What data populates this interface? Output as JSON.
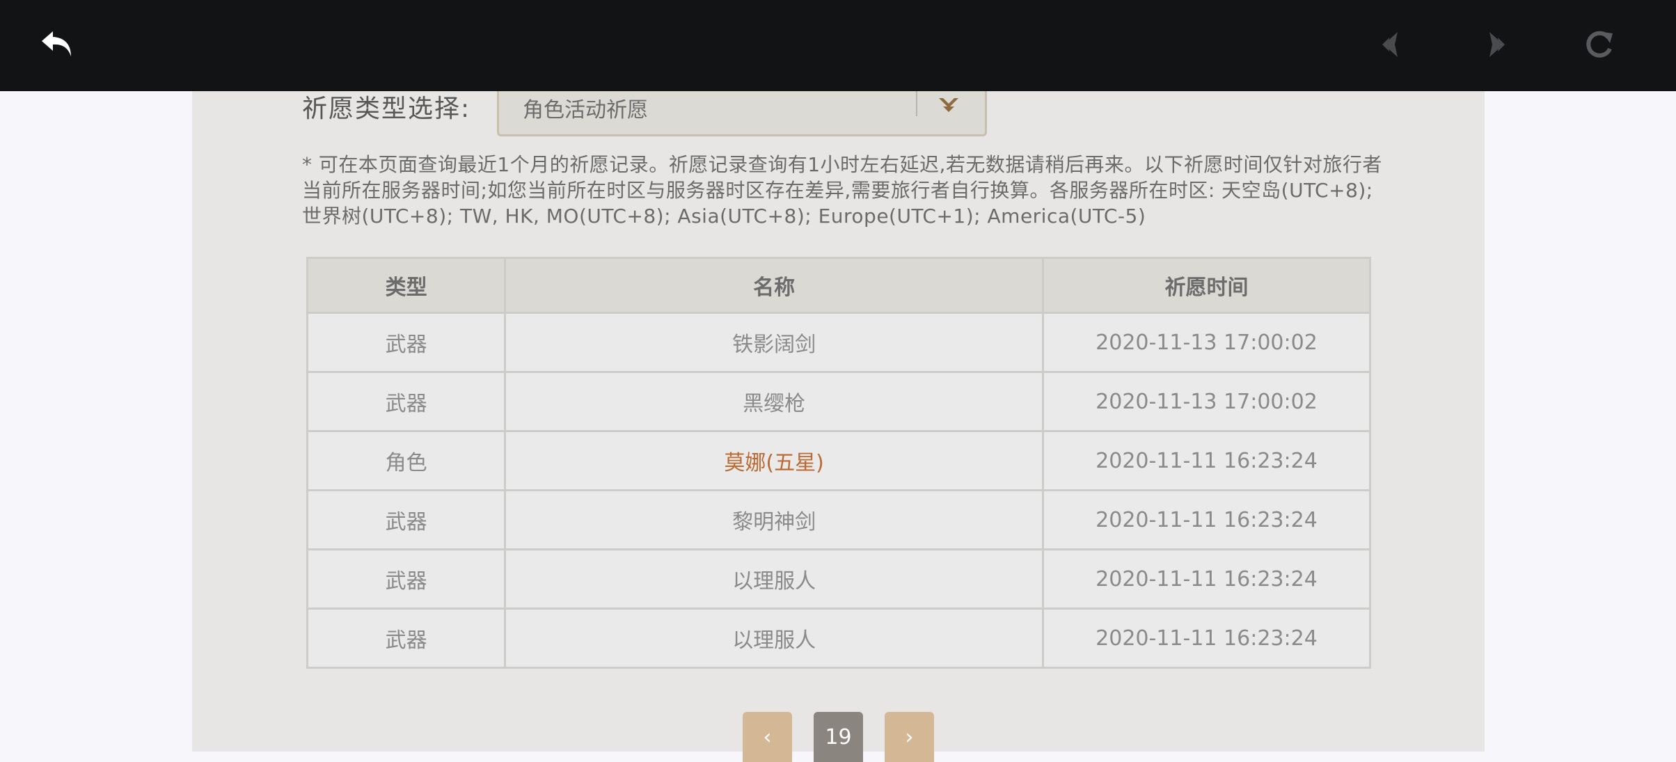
{
  "topbar": {
    "back_icon": "back-arrow-icon",
    "prev_icon": "prev-page-icon",
    "next_icon": "next-page-icon",
    "refresh_icon": "refresh-icon"
  },
  "selector": {
    "label": "祈愿类型选择:",
    "value": "角色活动祈愿"
  },
  "notice": "* 可在本页面查询最近1个月的祈愿记录。祈愿记录查询有1小时左右延迟,若无数据请稍后再来。以下祈愿时间仅针对旅行者当前所在服务器时间;如您当前所在时区与服务器时区存在差异,需要旅行者自行换算。各服务器所在时区: 天空岛(UTC+8); 世界树(UTC+8); TW, HK, MO(UTC+8); Asia(UTC+8); Europe(UTC+1); America(UTC-5)",
  "table": {
    "headers": [
      "类型",
      "名称",
      "祈愿时间"
    ],
    "rows": [
      {
        "type": "武器",
        "name": "铁影阔剑",
        "time": "2020-11-13 17:00:02",
        "highlight": false
      },
      {
        "type": "武器",
        "name": "黑缨枪",
        "time": "2020-11-13 17:00:02",
        "highlight": false
      },
      {
        "type": "角色",
        "name": "莫娜(五星)",
        "time": "2020-11-11 16:23:24",
        "highlight": true
      },
      {
        "type": "武器",
        "name": "黎明神剑",
        "time": "2020-11-11 16:23:24",
        "highlight": false
      },
      {
        "type": "武器",
        "name": "以理服人",
        "time": "2020-11-11 16:23:24",
        "highlight": false
      },
      {
        "type": "武器",
        "name": "以理服人",
        "time": "2020-11-11 16:23:24",
        "highlight": false
      }
    ]
  },
  "pager": {
    "prev": "‹",
    "page": "19",
    "next": "›"
  },
  "colors": {
    "topbar": "#121315",
    "highlight": "#bd6932",
    "pager_accent": "#d4b896",
    "pager_current": "#8b8580"
  }
}
